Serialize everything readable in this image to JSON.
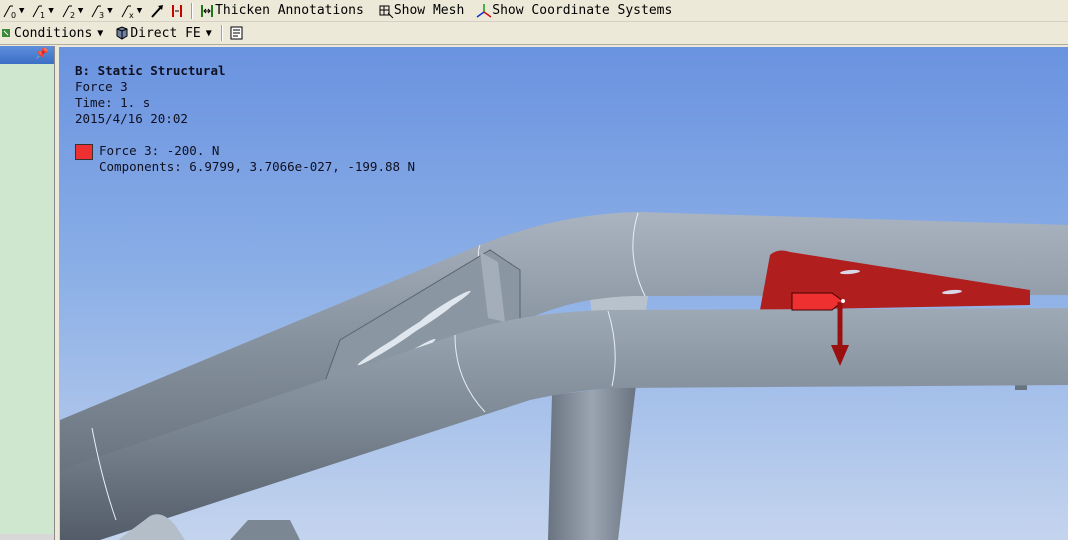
{
  "toolbar1": {
    "thicken_label": "Thicken Annotations",
    "mesh_label": "Show Mesh",
    "coord_label": "Show Coordinate Systems"
  },
  "toolbar2": {
    "conditions_label": "Conditions",
    "direct_fe_label": "Direct FE"
  },
  "annotation": {
    "title": "B: Static Structural",
    "name": "Force 3",
    "time": "Time: 1. s",
    "date": "2015/4/16 20:02",
    "legend_label": "Force 3: -200. N",
    "components": "Components: 6.9799, 3.7066e-027, -199.88 N"
  },
  "colors": {
    "force": "#ee3030",
    "geometry": "#8c98a4",
    "panel": "#cfe6cf"
  },
  "icons": {
    "pin": "pin-icon"
  }
}
